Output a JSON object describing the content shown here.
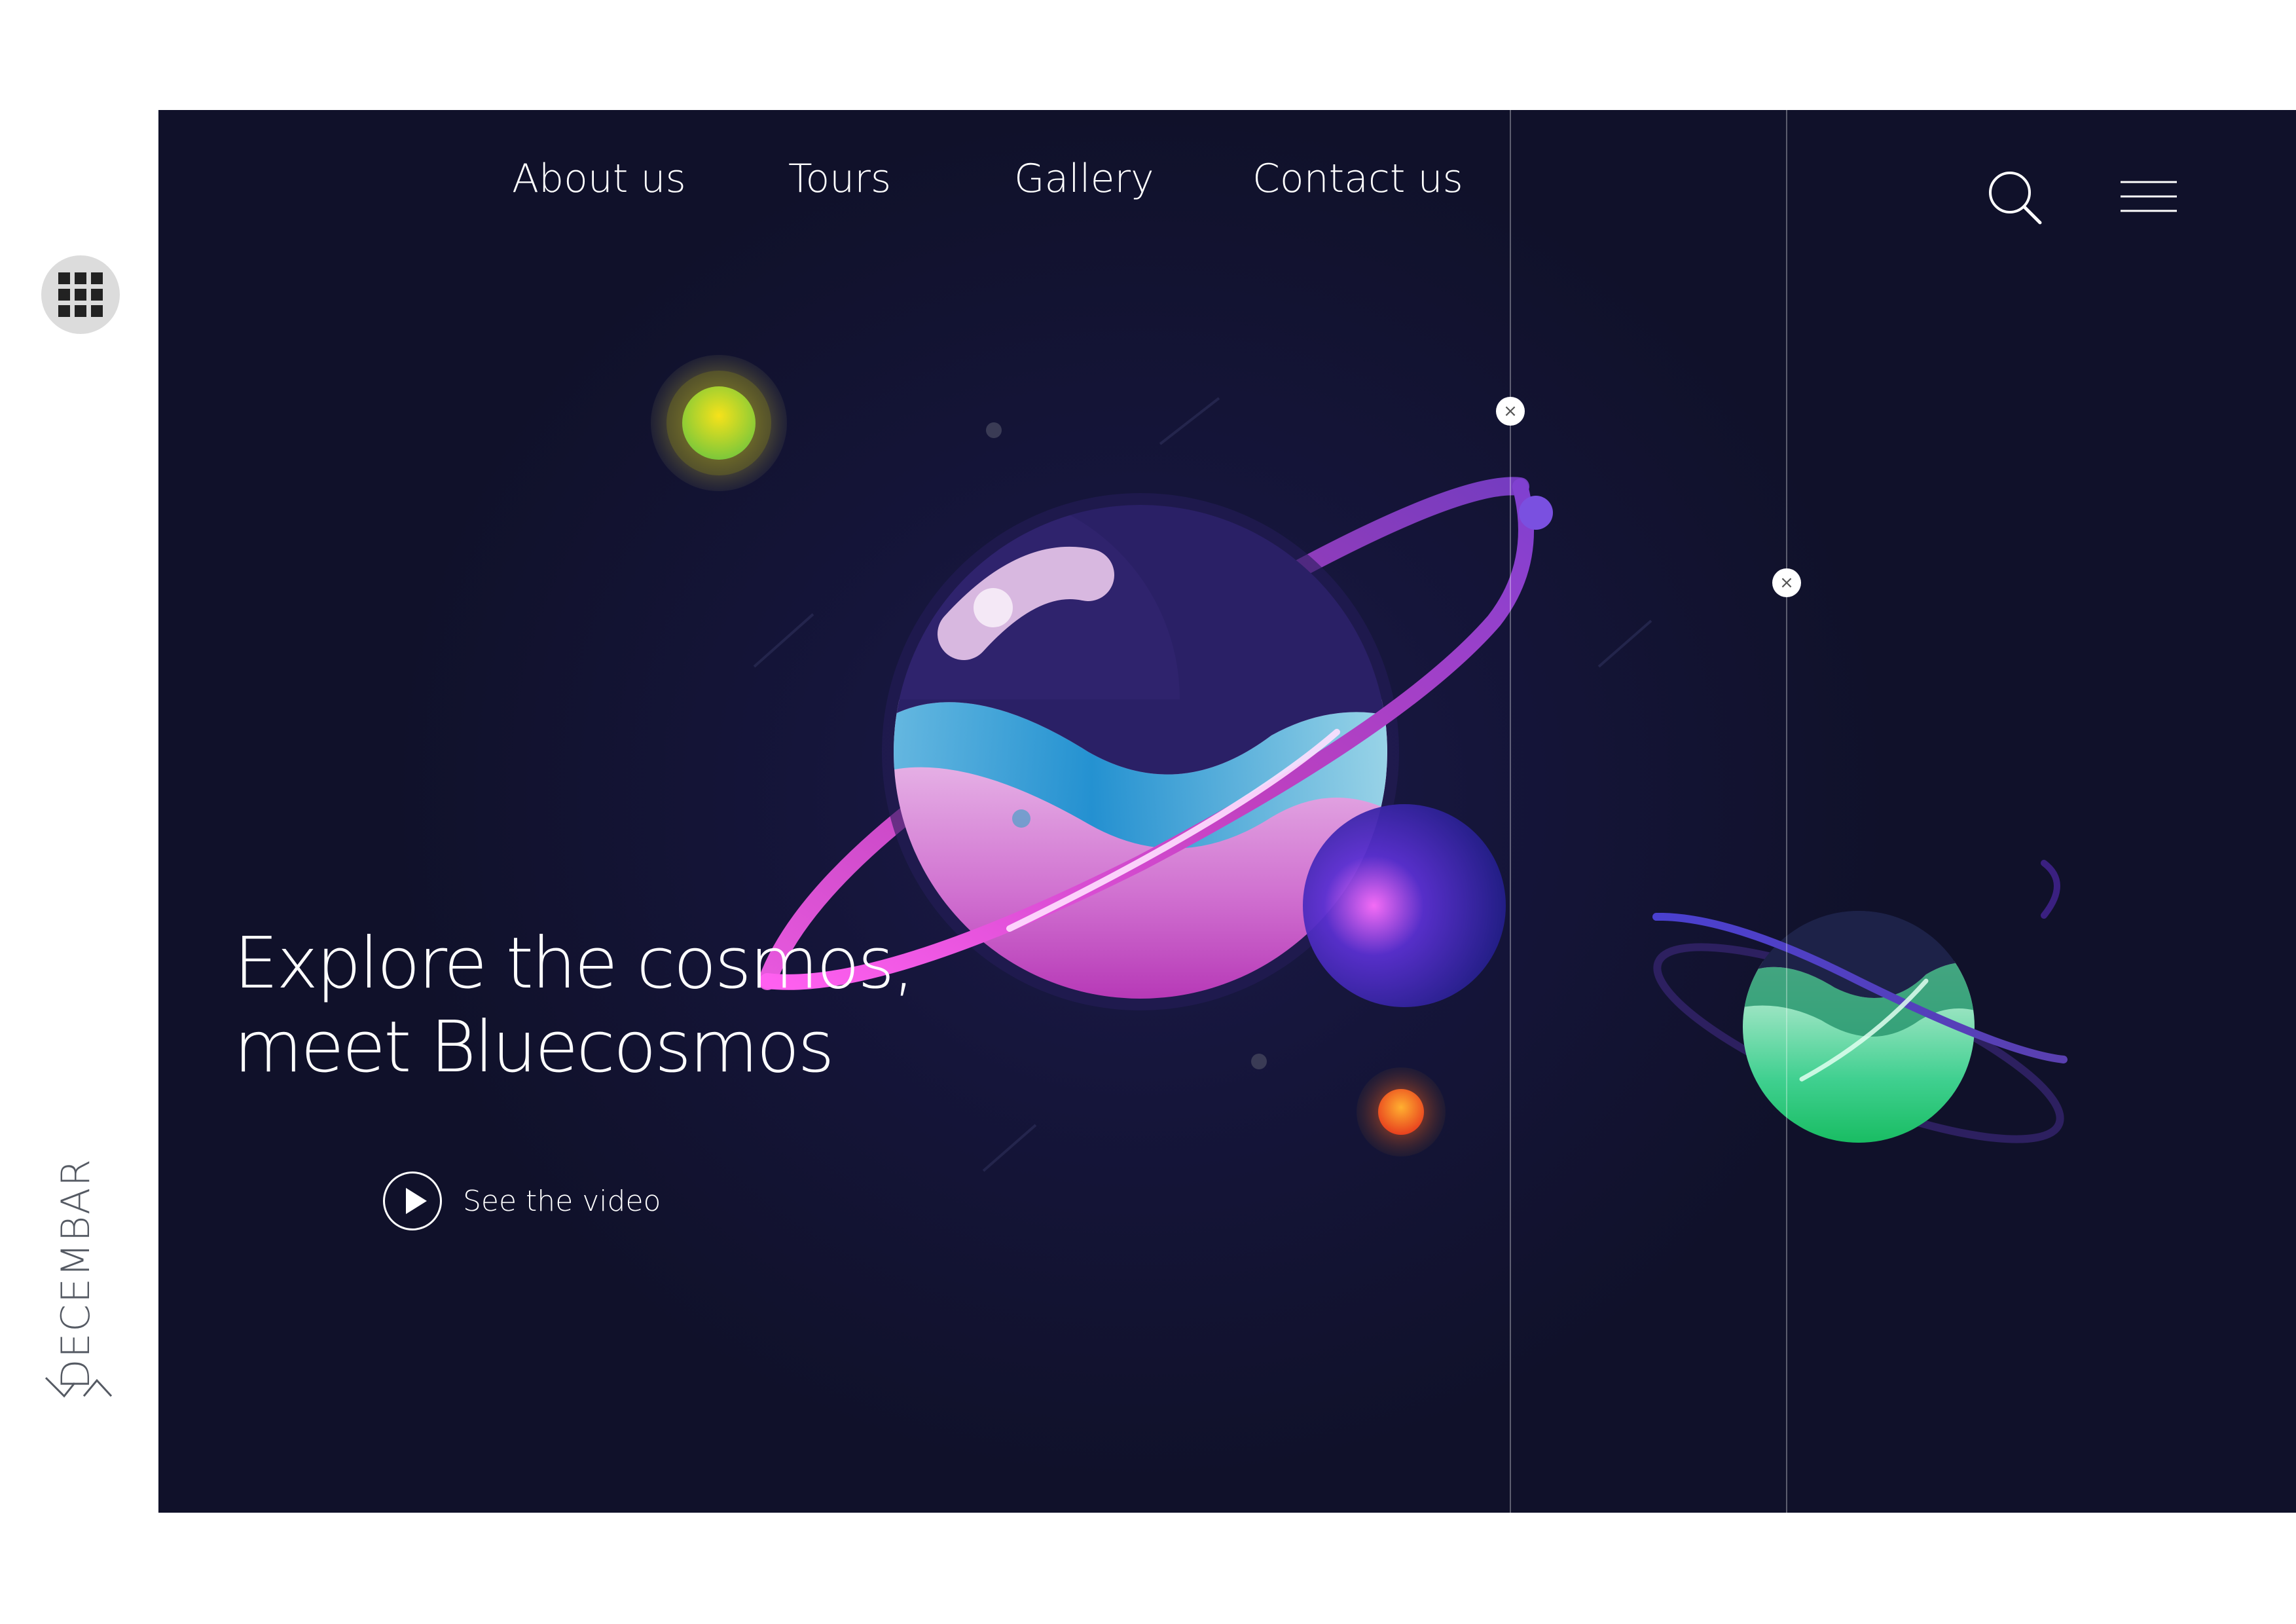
{
  "sidebar": {
    "apps_icon": "grid-icon",
    "month": "DECEMBAR",
    "month_nav_icon": "chevron-up-down-icon"
  },
  "nav": {
    "items": [
      {
        "label": "About us"
      },
      {
        "label": "Tours"
      },
      {
        "label": "Gallery"
      },
      {
        "label": "Contact us"
      }
    ],
    "search_icon": "search-icon",
    "menu_icon": "hamburger-icon"
  },
  "hero": {
    "headline_line1": "Explore the cosmos,",
    "headline_line2": "meet Bluecosmos",
    "video_label": "See the video",
    "video_icon": "play-icon",
    "marker_symbol": "×"
  },
  "colors": {
    "background": "#11122b",
    "accent_magenta": "#e040d0",
    "accent_cyan": "#38c8e8",
    "accent_green": "#19c46a",
    "sun_yellow": "#f0e020",
    "sun_orange": "#f06a20"
  }
}
